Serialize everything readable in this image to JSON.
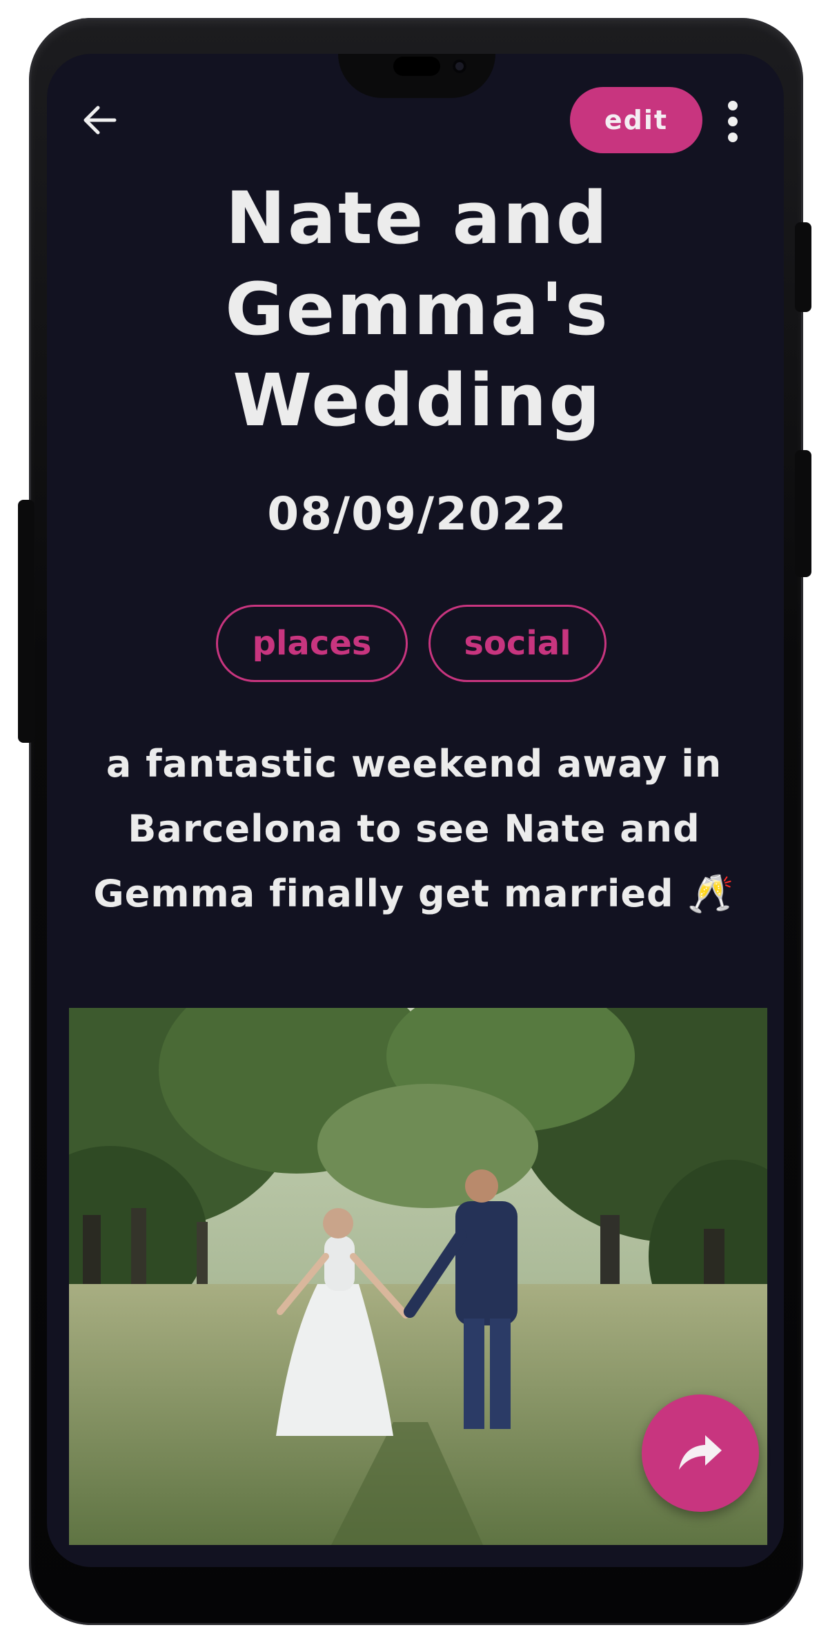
{
  "header": {
    "back_icon": "arrow-left-icon",
    "edit_label": "edit",
    "more_icon": "more-vertical-icon"
  },
  "entry": {
    "title_lines": [
      "Nate and",
      "Gemma's",
      "Wedding"
    ],
    "date": "08/09/2022",
    "tags": [
      "places",
      "social"
    ],
    "description": "a fantastic weekend away in Barcelona to see Nate and Gemma finally get married 🥂",
    "photo_alt": "wedding-couple-photo",
    "share_icon": "share-forward-icon"
  },
  "colors": {
    "accent": "#c8357f",
    "background": "#121221",
    "text": "#ececec"
  }
}
